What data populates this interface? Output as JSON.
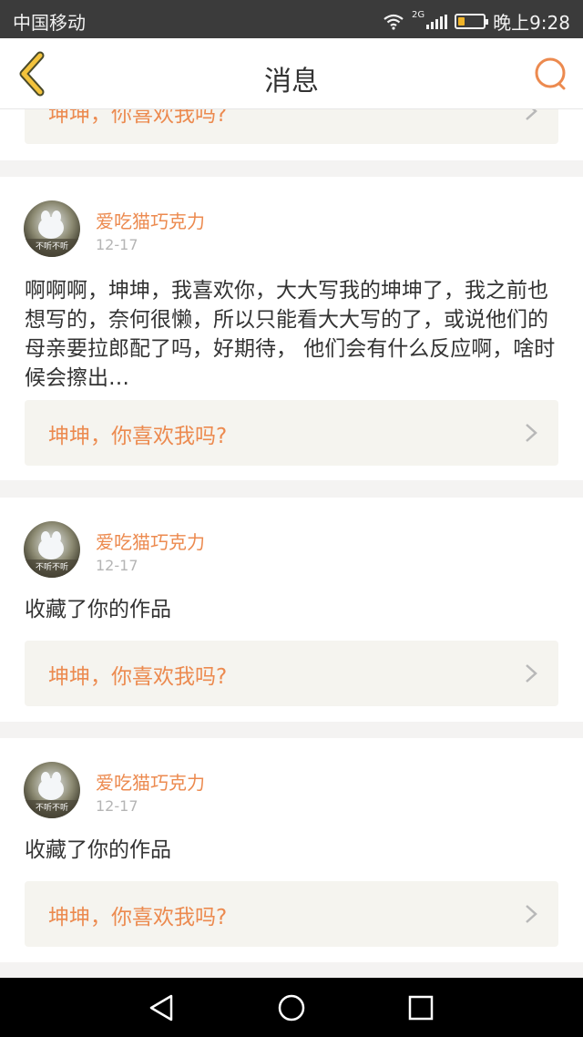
{
  "status_bar": {
    "carrier": "中国移动",
    "network_tag": "2G",
    "time": "晚上9:28"
  },
  "nav": {
    "title": "消息",
    "back_icon": "chevron-left-icon",
    "search_icon": "search-icon"
  },
  "colors": {
    "accent": "#ec8a4f",
    "back_icon": "#f3c33c",
    "link_bg": "#f5f4ef",
    "page_bg": "#f4f3f2"
  },
  "messages": [
    {
      "link_text": "坤坤，你喜欢我吗?"
    },
    {
      "user": "爱吃猫巧克力",
      "avatar_text": "不听不听",
      "date": "12-17",
      "body": "啊啊啊，坤坤，我喜欢你，大大写我的坤坤了，我之前也想写的，奈何很懒，所以只能看大大写的了，或说他们的母亲要拉郎配了吗，好期待， 他们会有什么反应啊，啥时候会擦出…",
      "link_text": "坤坤，你喜欢我吗?"
    },
    {
      "user": "爱吃猫巧克力",
      "avatar_text": "不听不听",
      "date": "12-17",
      "body": "收藏了你的作品",
      "link_text": "坤坤，你喜欢我吗?"
    },
    {
      "user": "爱吃猫巧克力",
      "avatar_text": "不听不听",
      "date": "12-17",
      "body": "收藏了你的作品",
      "link_text": "坤坤，你喜欢我吗?"
    }
  ]
}
